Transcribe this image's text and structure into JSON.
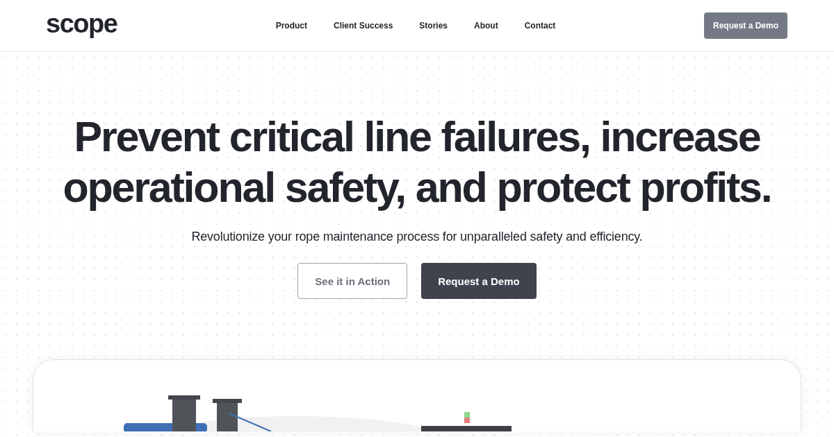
{
  "header": {
    "logo": "scope",
    "nav": [
      {
        "label": "Product"
      },
      {
        "label": "Client Success"
      },
      {
        "label": "Stories"
      },
      {
        "label": "About"
      },
      {
        "label": "Contact"
      }
    ],
    "cta": "Request a Demo"
  },
  "hero": {
    "headline": "Prevent critical line failures, increase operational safety, and protect profits.",
    "subtitle": "Revolutionize your rope maintenance process for unparalleled safety and efficiency.",
    "buttons": [
      {
        "label": "See it in Action",
        "kind": "outline"
      },
      {
        "label": "Request a Demo",
        "kind": "solid"
      }
    ]
  }
}
